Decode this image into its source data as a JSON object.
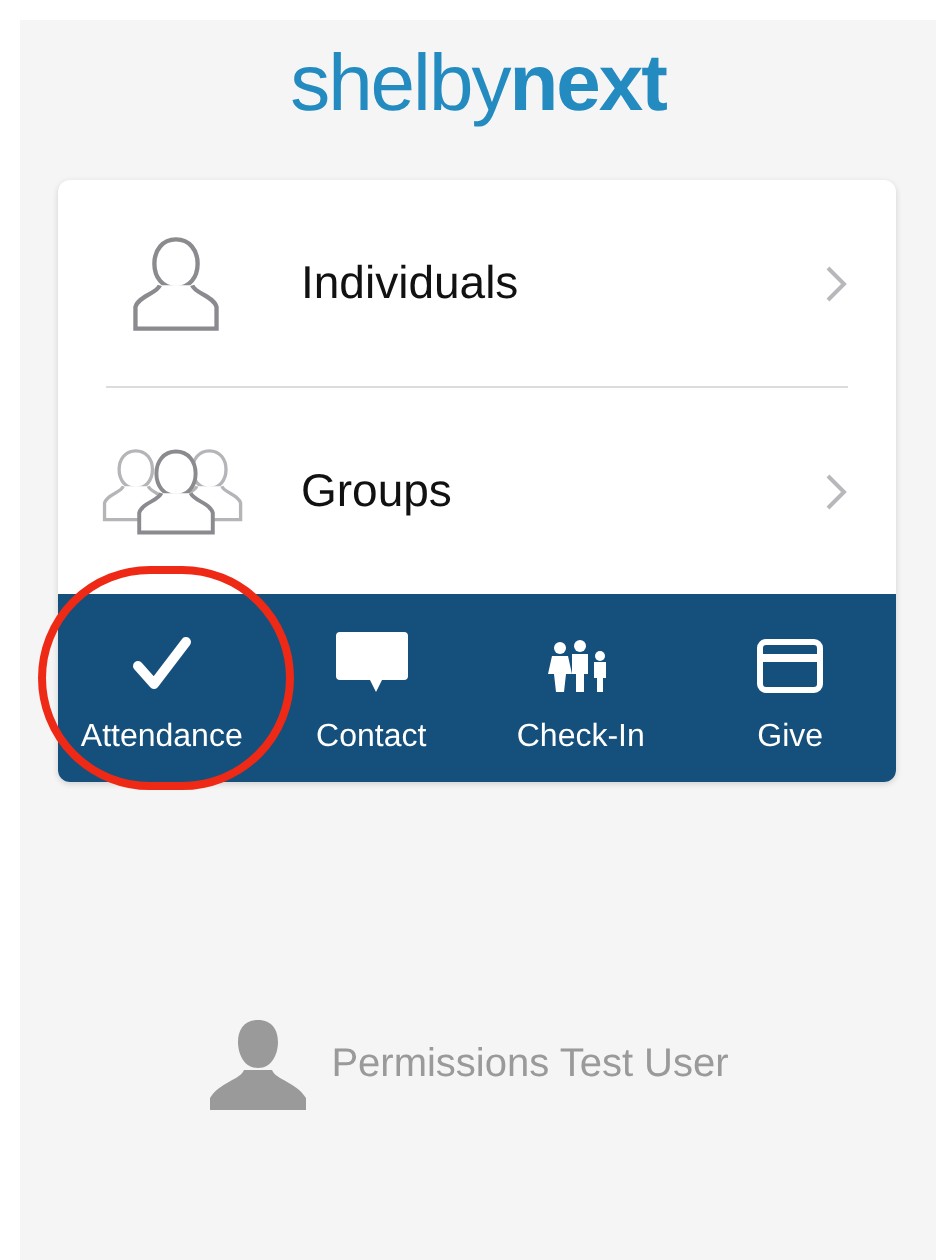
{
  "logo": {
    "light": "shelby",
    "bold": "next"
  },
  "menu": [
    {
      "kind": "single",
      "label": "Individuals"
    },
    {
      "kind": "group",
      "label": "Groups"
    }
  ],
  "actions": [
    {
      "kind": "check",
      "label": "Attendance",
      "circled": true
    },
    {
      "kind": "chat",
      "label": "Contact",
      "circled": false
    },
    {
      "kind": "family",
      "label": "Check-In",
      "circled": false
    },
    {
      "kind": "card",
      "label": "Give",
      "circled": false
    }
  ],
  "user": {
    "name": "Permissions Test User"
  }
}
